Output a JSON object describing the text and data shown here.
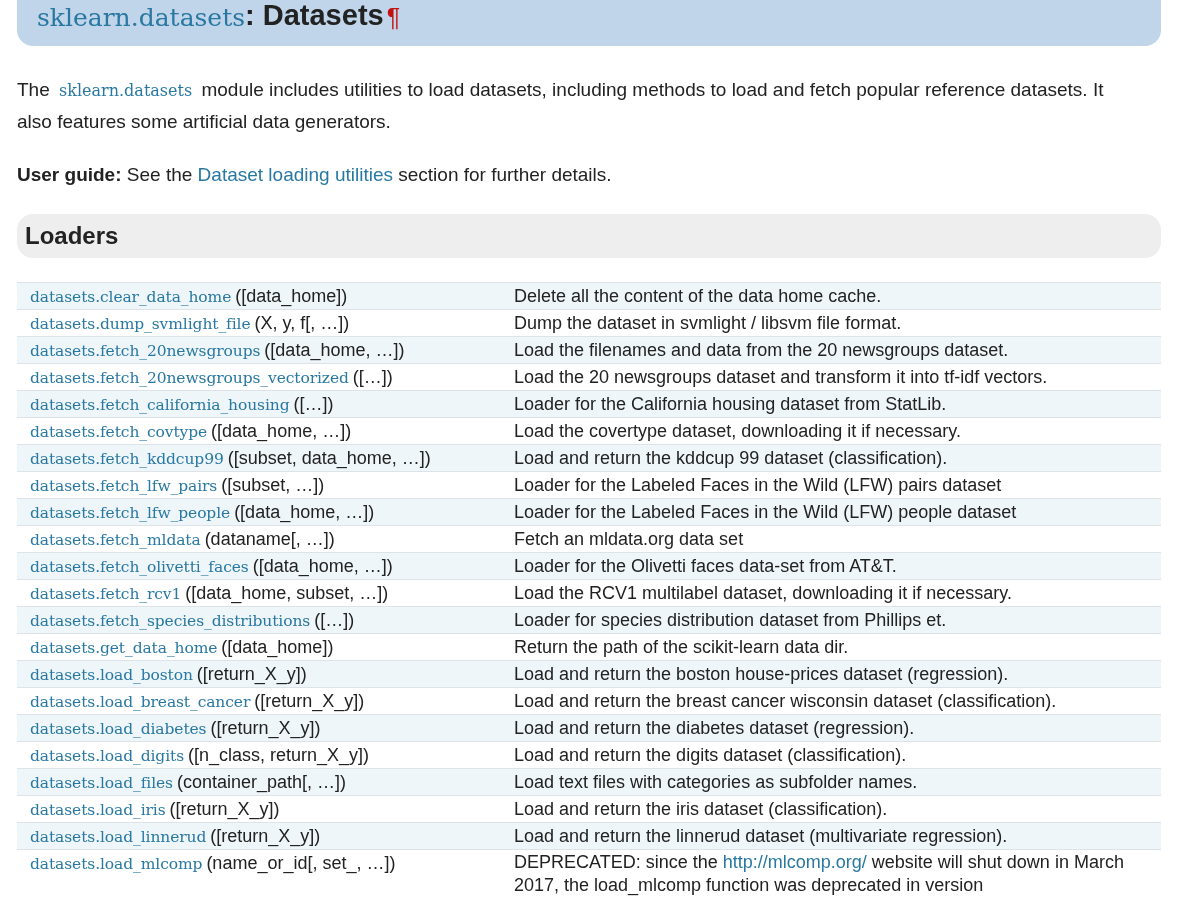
{
  "heading": {
    "module": "sklearn.datasets",
    "title": ": Datasets",
    "pilcrow": "¶"
  },
  "intro": {
    "before": "The ",
    "code": "sklearn.datasets",
    "after": " module includes utilities to load datasets, including methods to load and fetch popular reference datasets. It also features some artificial data generators."
  },
  "user_guide": {
    "label": "User guide:",
    "before": " See the ",
    "link": "Dataset loading utilities",
    "after": " section for further details."
  },
  "section": {
    "title": "Loaders"
  },
  "table": {
    "rows": [
      {
        "function": "datasets.clear_data_home",
        "signature": "([data_home])",
        "description": "Delete all the content of the data home cache."
      },
      {
        "function": "datasets.dump_svmlight_file",
        "signature": "(X, y, f[, …])",
        "description": "Dump the dataset in svmlight / libsvm file format."
      },
      {
        "function": "datasets.fetch_20newsgroups",
        "signature": "([data_home, …])",
        "description": "Load the filenames and data from the 20 newsgroups dataset."
      },
      {
        "function": "datasets.fetch_20newsgroups_vectorized",
        "signature": "([…])",
        "description": "Load the 20 newsgroups dataset and transform it into tf-idf vectors."
      },
      {
        "function": "datasets.fetch_california_housing",
        "signature": "([…])",
        "description": "Loader for the California housing dataset from StatLib."
      },
      {
        "function": "datasets.fetch_covtype",
        "signature": "([data_home, …])",
        "description": "Load the covertype dataset, downloading it if necessary."
      },
      {
        "function": "datasets.fetch_kddcup99",
        "signature": "([subset, data_home, …])",
        "description": "Load and return the kddcup 99 dataset (classification)."
      },
      {
        "function": "datasets.fetch_lfw_pairs",
        "signature": "([subset, …])",
        "description": "Loader for the Labeled Faces in the Wild (LFW) pairs dataset"
      },
      {
        "function": "datasets.fetch_lfw_people",
        "signature": "([data_home, …])",
        "description": "Loader for the Labeled Faces in the Wild (LFW) people dataset"
      },
      {
        "function": "datasets.fetch_mldata",
        "signature": "(dataname[, …])",
        "description": "Fetch an mldata.org data set"
      },
      {
        "function": "datasets.fetch_olivetti_faces",
        "signature": "([data_home, …])",
        "description": "Loader for the Olivetti faces data-set from AT&T."
      },
      {
        "function": "datasets.fetch_rcv1",
        "signature": "([data_home, subset, …])",
        "description": "Load the RCV1 multilabel dataset, downloading it if necessary."
      },
      {
        "function": "datasets.fetch_species_distributions",
        "signature": "([…])",
        "description": "Loader for species distribution dataset from Phillips et."
      },
      {
        "function": "datasets.get_data_home",
        "signature": "([data_home])",
        "description": "Return the path of the scikit-learn data dir."
      },
      {
        "function": "datasets.load_boston",
        "signature": "([return_X_y])",
        "description": "Load and return the boston house-prices dataset (regression)."
      },
      {
        "function": "datasets.load_breast_cancer",
        "signature": "([return_X_y])",
        "description": "Load and return the breast cancer wisconsin dataset (classification)."
      },
      {
        "function": "datasets.load_diabetes",
        "signature": "([return_X_y])",
        "description": "Load and return the diabetes dataset (regression)."
      },
      {
        "function": "datasets.load_digits",
        "signature": "([n_class, return_X_y])",
        "description": "Load and return the digits dataset (classification)."
      },
      {
        "function": "datasets.load_files",
        "signature": "(container_path[, …])",
        "description": "Load text files with categories as subfolder names."
      },
      {
        "function": "datasets.load_iris",
        "signature": "([return_X_y])",
        "description": "Load and return the iris dataset (classification)."
      },
      {
        "function": "datasets.load_linnerud",
        "signature": "([return_X_y])",
        "description": "Load and return the linnerud dataset (multivariate regression)."
      },
      {
        "function": "datasets.load_mlcomp",
        "signature": "(name_or_id[, set_, …])",
        "description": "DEPRECATED: since the ",
        "link": "http://mlcomp.org/",
        "description_after": " website will shut down in March 2017, the load_mlcomp function was deprecated in version"
      }
    ]
  }
}
